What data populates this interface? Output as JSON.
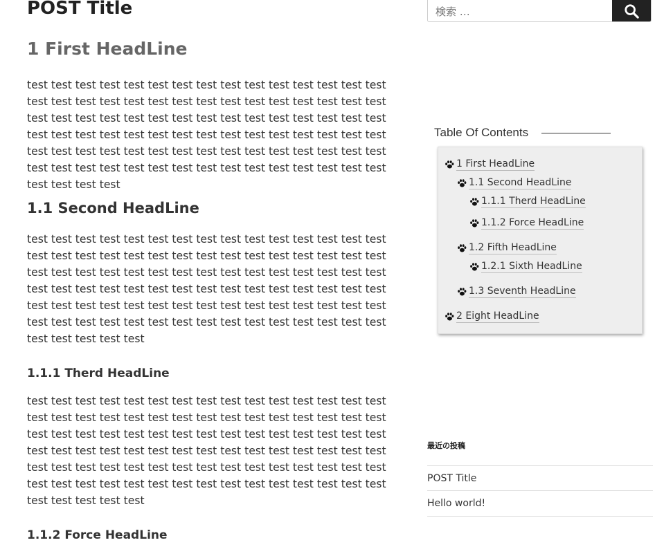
{
  "post": {
    "title": "POST Title",
    "sections": [
      {
        "heading": "1 First HeadLine",
        "body": "test test test test test test test test test test test test test test test test test test test test test test test test test test test test test test test test test test test test test test test test test test test test test test test test test test test test test test test test test test test test test test test test test test test test test test test test test test test test test test test test test test test test test test test test test test test test test test"
      },
      {
        "heading": "1.1 Second HeadLine",
        "body": "test test test test test test test test test test test test test test test test test test test test test test test test test test test test test test test test test test test test test test test test test test test test test test test test test test test test test test test test test test test test test test test test test test test test test test test test test test test test test test test test test test test test test test test test test test test test test test test"
      },
      {
        "heading": "1.1.1 Therd HeadLine",
        "body": "test test test test test test test test test test test test test test test test test test test test test test test test test test test test test test test test test test test test test test test test test test test test test test test test test test test test test test test test test test test test test test test test test test test test test test test test test test test test test test test test test test test test test test test test test test test test test test test"
      },
      {
        "heading": "1.1.2 Force HeadLine"
      }
    ]
  },
  "search": {
    "placeholder": "検索 …",
    "icon": "search-icon"
  },
  "toc": {
    "title": "Table Of Contents",
    "icon": "paw-icon",
    "items": [
      {
        "label": "1 First HeadLine"
      },
      {
        "label": "1.1 Second HeadLine"
      },
      {
        "label": "1.1.1 Therd HeadLine"
      },
      {
        "label": "1.1.2 Force HeadLine"
      },
      {
        "label": "1.2 Fifth HeadLine"
      },
      {
        "label": "1.2.1 Sixth HeadLine"
      },
      {
        "label": "1.3 Seventh HeadLine"
      },
      {
        "label": "2 Eight HeadLine"
      }
    ]
  },
  "recent_posts": {
    "heading": "最近の投稿",
    "items": [
      {
        "label": "POST Title"
      },
      {
        "label": "Hello world!"
      }
    ]
  },
  "colors": {
    "search_button": "#222222",
    "toc_background": "#eeeeee",
    "first_heading": "#666666",
    "text": "#333333"
  }
}
